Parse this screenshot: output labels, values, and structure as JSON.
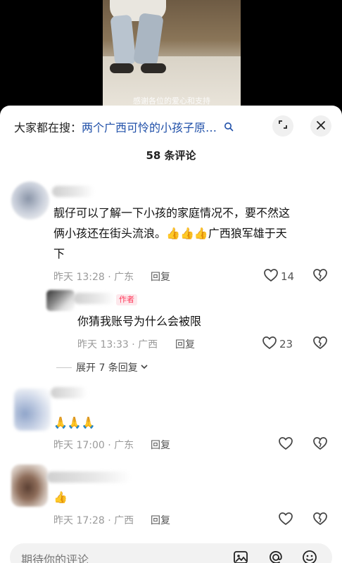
{
  "video": {
    "caption": "感谢各位的爱心和支持"
  },
  "search": {
    "prefix": "大家都在搜：",
    "query": "两个广西可怜的小孩子原…"
  },
  "comments_title": "58 条评论",
  "comments": [
    {
      "text": "靓仔可以了解一下小孩的家庭情况不，要不然这俩小孩还在街头流浪。👍👍👍广西狼军雄于天下",
      "line1": "靓仔可以了解一下小孩的家庭情况不，要不然这",
      "line2_pre": "俩小孩还在街头流浪。",
      "line2_post": "广西狼军雄于天",
      "line3": "下",
      "time": "昨天 13:28 · 广东",
      "reply_label": "回复",
      "likes": "14"
    },
    {
      "author_badge": "作者",
      "text": "你猜我账号为什么会被限",
      "time": "昨天 13:33 · 广西",
      "reply_label": "回复",
      "likes": "23"
    }
  ],
  "expand_replies": "展开 7 条回复",
  "comment3": {
    "text": "🙏🙏🙏",
    "time": "昨天 17:00 · 广东",
    "reply_label": "回复"
  },
  "comment4": {
    "text": "👍",
    "time": "昨天 17:28 · 广西",
    "reply_label": "回复"
  },
  "input": {
    "placeholder": "期待你的评论"
  },
  "colors": {
    "link": "#1f4fa8",
    "author_badge": "#ff3b5c"
  }
}
